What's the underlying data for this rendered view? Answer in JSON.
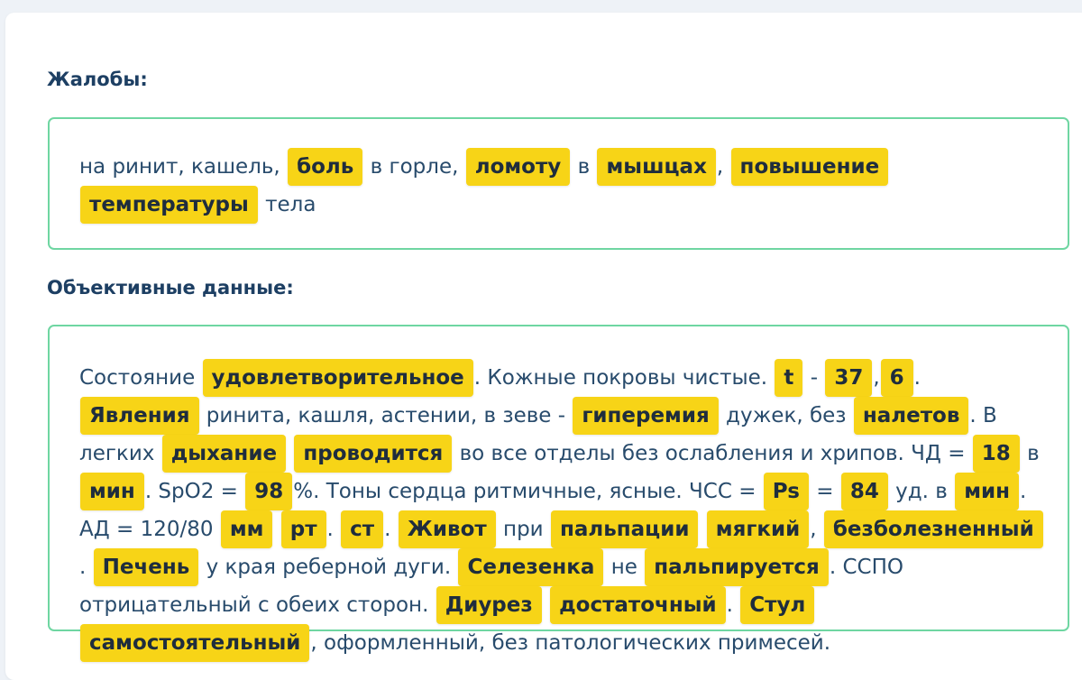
{
  "complaints": {
    "title": "Жалобы:",
    "segments": [
      {
        "text": "на ринит, кашель, ",
        "hl": false
      },
      {
        "text": "боль",
        "hl": true
      },
      {
        "text": " в горле, ",
        "hl": false
      },
      {
        "text": "ломоту",
        "hl": true
      },
      {
        "text": " в ",
        "hl": false
      },
      {
        "text": "мышцах",
        "hl": true
      },
      {
        "text": ", ",
        "hl": false
      },
      {
        "text": "повышение",
        "hl": true
      },
      {
        "text": " ",
        "hl": false
      },
      {
        "text": "температуры",
        "hl": true
      },
      {
        "text": " тела",
        "hl": false
      }
    ]
  },
  "objective": {
    "title": "Объективные данные:",
    "segments": [
      {
        "text": "Состояние ",
        "hl": false
      },
      {
        "text": "удовлетворительное",
        "hl": true
      },
      {
        "text": ". Кожные покровы чистые. ",
        "hl": false
      },
      {
        "text": "t",
        "hl": true
      },
      {
        "text": " - ",
        "hl": false
      },
      {
        "text": "37",
        "hl": true
      },
      {
        "text": ",",
        "hl": false
      },
      {
        "text": "6",
        "hl": true
      },
      {
        "text": ". ",
        "hl": false
      },
      {
        "text": "Явления",
        "hl": true
      },
      {
        "text": " ринита, кашля, астении, в зеве - ",
        "hl": false
      },
      {
        "text": "гиперемия",
        "hl": true
      },
      {
        "text": " дужек, без ",
        "hl": false
      },
      {
        "text": "налетов",
        "hl": true
      },
      {
        "text": ". В легких ",
        "hl": false
      },
      {
        "text": "дыхание",
        "hl": true
      },
      {
        "text": " ",
        "hl": false
      },
      {
        "text": "проводится",
        "hl": true
      },
      {
        "text": " во все отделы без ослабления и хрипов. ЧД = ",
        "hl": false
      },
      {
        "text": "18",
        "hl": true
      },
      {
        "text": " в ",
        "hl": false
      },
      {
        "text": "мин",
        "hl": true
      },
      {
        "text": ". SpO2 = ",
        "hl": false
      },
      {
        "text": "98",
        "hl": true
      },
      {
        "text": "%. Тоны сердца ритмичные, ясные. ЧСС = ",
        "hl": false
      },
      {
        "text": "Ps",
        "hl": true
      },
      {
        "text": " = ",
        "hl": false
      },
      {
        "text": "84",
        "hl": true
      },
      {
        "text": " уд. в ",
        "hl": false
      },
      {
        "text": "мин",
        "hl": true
      },
      {
        "text": ". АД = 120/80 ",
        "hl": false
      },
      {
        "text": "мм",
        "hl": true
      },
      {
        "text": " ",
        "hl": false
      },
      {
        "text": "рт",
        "hl": true
      },
      {
        "text": ". ",
        "hl": false
      },
      {
        "text": "ст",
        "hl": true
      },
      {
        "text": ". ",
        "hl": false
      },
      {
        "text": "Живот",
        "hl": true
      },
      {
        "text": " при ",
        "hl": false
      },
      {
        "text": "пальпации",
        "hl": true
      },
      {
        "text": " ",
        "hl": false
      },
      {
        "text": "мягкий",
        "hl": true
      },
      {
        "text": ", ",
        "hl": false
      },
      {
        "text": "безболезненный",
        "hl": true
      },
      {
        "text": ". ",
        "hl": false
      },
      {
        "text": "Печень",
        "hl": true
      },
      {
        "text": " у края реберной дуги. ",
        "hl": false
      },
      {
        "text": "Селезенка",
        "hl": true
      },
      {
        "text": " не ",
        "hl": false
      },
      {
        "text": "пальпируется",
        "hl": true
      },
      {
        "text": ". ССПО отрицательный с обеих сторон. ",
        "hl": false
      },
      {
        "text": "Диурез",
        "hl": true
      },
      {
        "text": " ",
        "hl": false
      },
      {
        "text": "достаточный",
        "hl": true
      },
      {
        "text": ". ",
        "hl": false
      },
      {
        "text": "Стул",
        "hl": true
      },
      {
        "text": " ",
        "hl": false
      },
      {
        "text": "самостоятельный",
        "hl": true
      },
      {
        "text": ", оформленный, без патологических примесей.",
        "hl": false
      }
    ]
  },
  "colors": {
    "highlight": "#f7d417",
    "box_border": "#6fd6a2",
    "title": "#1d3f63",
    "body_text": "#284b6c",
    "page_background": "#eef2f7"
  }
}
